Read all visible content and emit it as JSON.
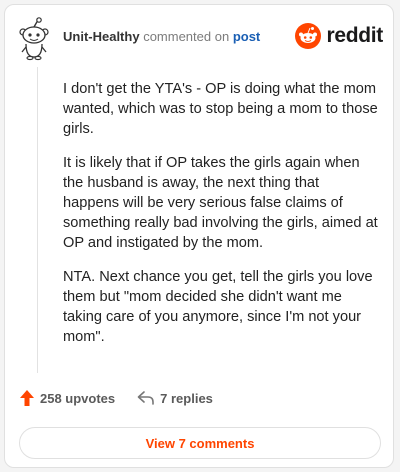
{
  "comment": {
    "username": "Unit-Healthy",
    "action": "commented on",
    "target_link": "post",
    "paragraphs": [
      "I don't get the YTA's - OP is doing what the mom wanted, which was to stop being a mom to those girls.",
      "It is likely that if OP takes the girls again when the husband is away, the next thing that happens will be very serious false claims of something really bad involving the girls, aimed at OP and instigated by the mom.",
      "NTA. Next chance you get, tell the girls you love them but \"mom decided she didn't want me taking care of you anymore, since I'm not your mom\"."
    ]
  },
  "brand": {
    "name": "reddit",
    "icon": "reddit-logo-icon",
    "color": "#ff4500"
  },
  "footer": {
    "upvotes_label": "258 upvotes",
    "upvote_icon": "upvote-arrow-icon",
    "replies_label": "7 replies",
    "reply_icon": "reply-arrow-icon"
  },
  "view_comments_label": "View 7 comments",
  "colors": {
    "accent": "#ff4500",
    "link": "#1a5fb4"
  }
}
